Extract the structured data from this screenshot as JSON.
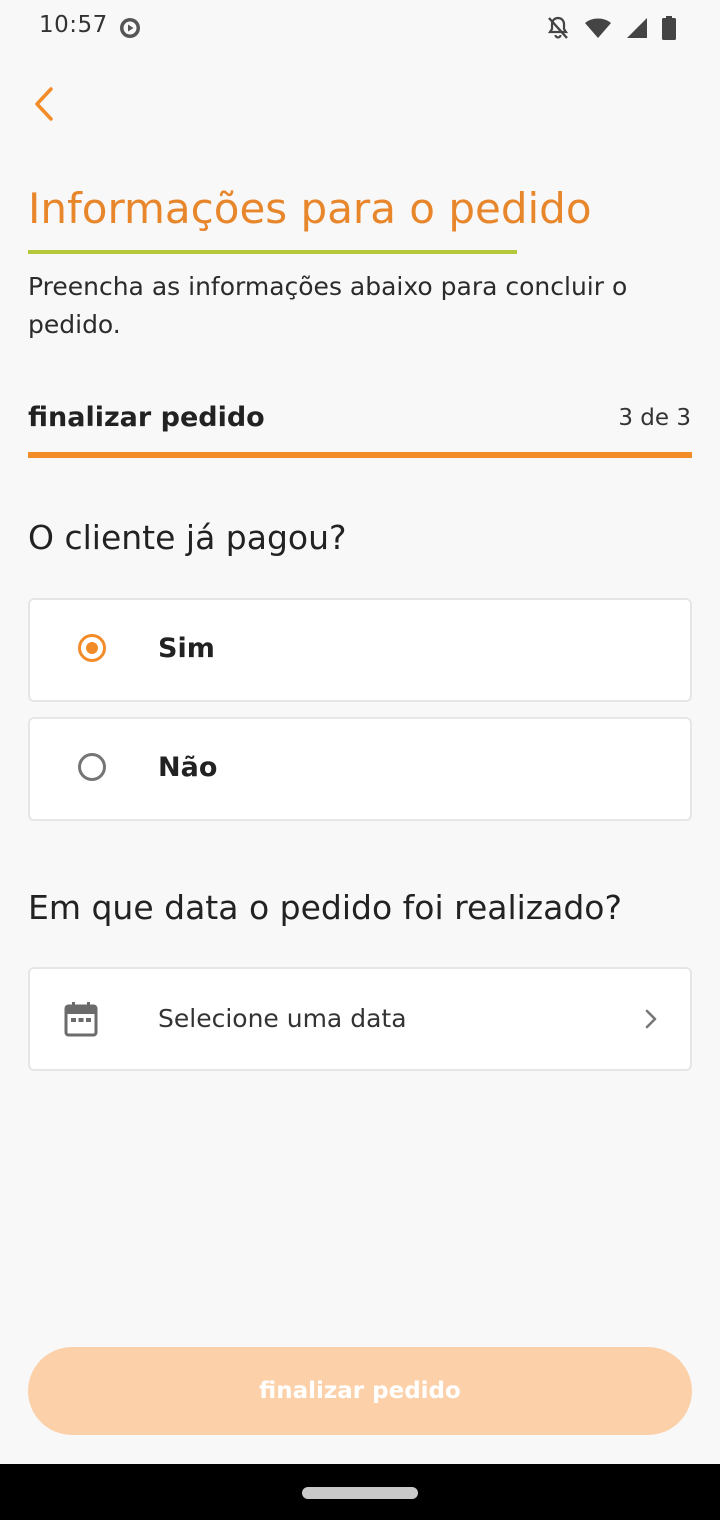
{
  "status_bar": {
    "time": "10:57",
    "icons": [
      "play-icon",
      "bell-off-icon",
      "wifi-icon",
      "signal-icon",
      "battery-icon"
    ]
  },
  "header": {
    "back_icon": "chevron-left-icon",
    "title": "Informações para o pedido",
    "subtitle": "Preencha as informações abaixo para concluir o pedido."
  },
  "step": {
    "label": "finalizar pedido",
    "counter": "3 de 3",
    "progress_fraction": 1.0
  },
  "payment": {
    "question": "O cliente já pagou?",
    "options": [
      {
        "label": "Sim",
        "selected": true
      },
      {
        "label": "Não",
        "selected": false
      }
    ]
  },
  "date": {
    "question": "Em que data o pedido foi realizado?",
    "placeholder": "Selecione uma data",
    "icon": "calendar-icon"
  },
  "footer": {
    "submit_label": "finalizar pedido",
    "submit_enabled": false
  },
  "colors": {
    "accent": "#f28c28",
    "title": "#e8862c",
    "underline": "#b5c73a",
    "button_disabled": "#fcd1aa"
  }
}
